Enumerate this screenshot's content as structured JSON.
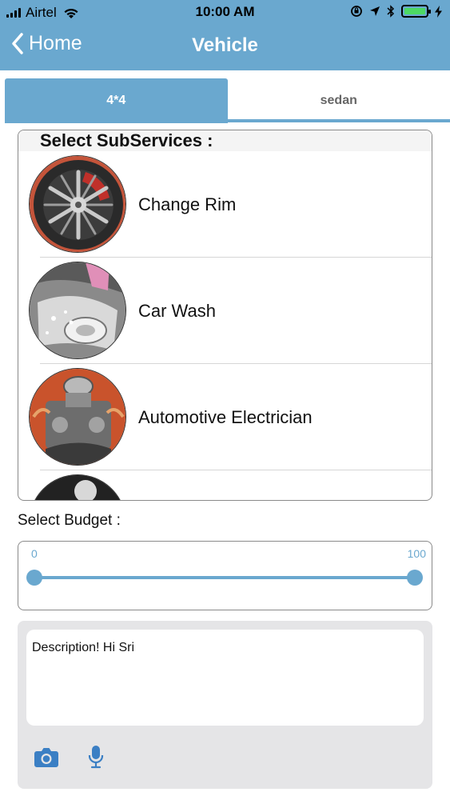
{
  "status_bar": {
    "carrier": "Airtel",
    "time": "10:00 AM",
    "battery_level": 1.0
  },
  "nav": {
    "back_label": "Home",
    "title": "Vehicle"
  },
  "tabs": [
    {
      "label": "4*4",
      "active": true
    },
    {
      "label": "sedan",
      "active": false
    }
  ],
  "subservices": {
    "heading": "Select SubServices :",
    "items": [
      {
        "label": "Change Rim"
      },
      {
        "label": "Car Wash"
      },
      {
        "label": "Automotive Electrician"
      },
      {
        "label": ""
      }
    ]
  },
  "budget": {
    "label": "Select Budget :",
    "min_label": "0",
    "max_label": "100",
    "min": 0,
    "max": 100,
    "low": 0,
    "high": 100
  },
  "description": {
    "value": "Description! Hi Sri"
  },
  "colors": {
    "accent": "#6aa8cf",
    "icon": "#3b7fc4"
  }
}
